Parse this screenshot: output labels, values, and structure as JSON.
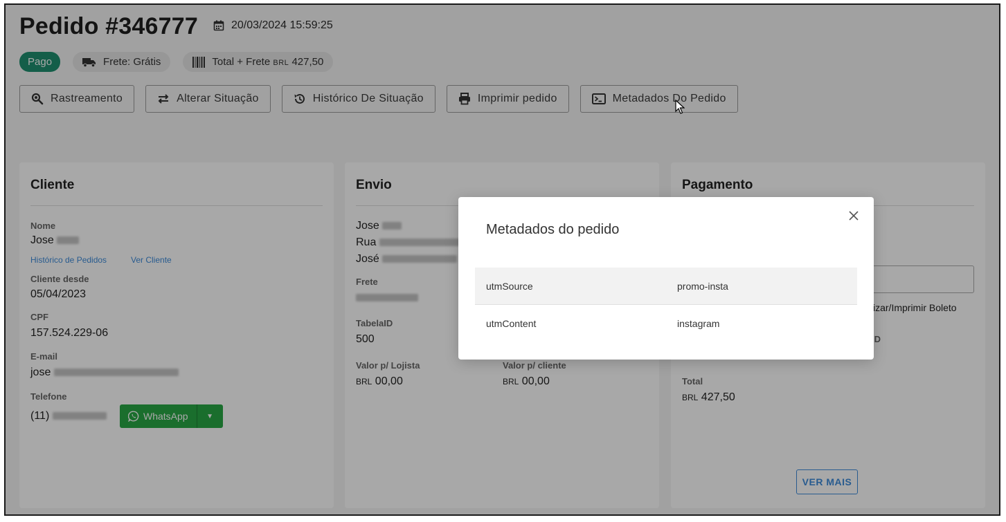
{
  "order": {
    "title": "Pedido #346777",
    "datetime": "20/03/2024 15:59:25",
    "status": "Pago",
    "shipping_chip": "Frete: Grátis",
    "total_chip_prefix": "Total + Frete",
    "total_chip_currency": "BRL",
    "total_chip_value": "427,50"
  },
  "actions": [
    {
      "label": "Rastreamento",
      "icon": "search-icon"
    },
    {
      "label": "Alterar Situação",
      "icon": "swap-icon"
    },
    {
      "label": "Histórico De Situação",
      "icon": "history-icon"
    },
    {
      "label": "Imprimir pedido",
      "icon": "printer-icon"
    },
    {
      "label": "Metadados Do Pedido",
      "icon": "terminal-icon"
    }
  ],
  "client": {
    "heading": "Cliente",
    "name_label": "Nome",
    "name": "Jose",
    "orders_link": "Histórico de Pedidos",
    "view_client_link": "Ver Cliente",
    "since_label": "Cliente desde",
    "since": "05/04/2023",
    "cpf_label": "CPF",
    "cpf": "157.524.229-06",
    "email_label": "E-mail",
    "email": "jose",
    "phone_label": "Telefone",
    "phone": "(11)",
    "whatsapp_label": "WhatsApp"
  },
  "shipping": {
    "heading": "Envio",
    "line1": "Jose",
    "line2": "Rua",
    "line3": "José",
    "frete_label": "Frete",
    "tabela_label": "TabelaID",
    "tabela": "500",
    "store_value_label": "Valor p/ Lojista",
    "store_value_currency": "BRL",
    "store_value": "00,00",
    "client_value_label": "Valor p/ cliente",
    "client_value_currency": "BRL",
    "client_value": "00,00"
  },
  "payment": {
    "heading": "Pagamento",
    "boleto_text": "izar/Imprimir Boleto",
    "id_fragment": "ID",
    "total_label": "Total",
    "total_currency": "BRL",
    "total": "427,50",
    "more_label": "VER MAIS"
  },
  "modal": {
    "title": "Metadados do pedido",
    "rows": [
      {
        "key": "utmSource",
        "value": "promo-insta"
      },
      {
        "key": "utmContent",
        "value": "instagram"
      }
    ]
  },
  "colors": {
    "paid_badge": "#1f8f6f",
    "whatsapp": "#28a745",
    "link": "#3d8bd9"
  }
}
